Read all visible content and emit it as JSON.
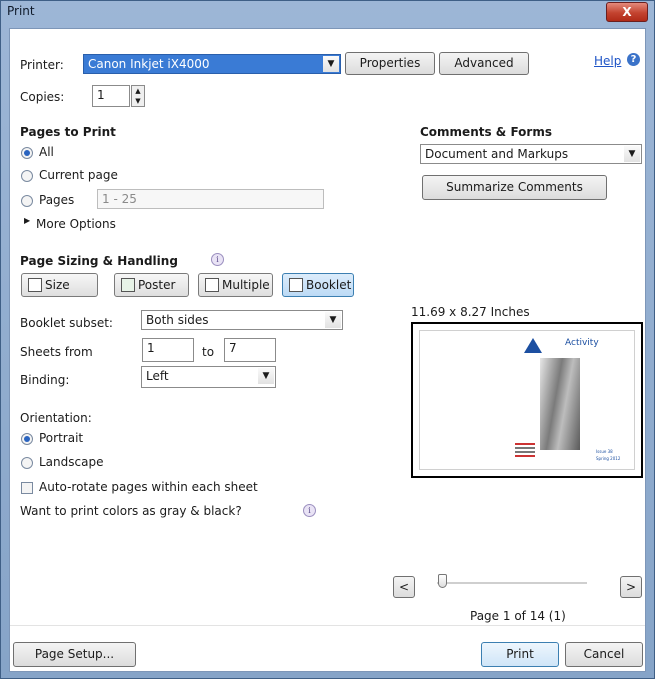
{
  "window": {
    "title": "Print",
    "close_label": "X"
  },
  "printer": {
    "label": "Printer:",
    "value": "Canon Inkjet iX4000",
    "properties_label": "Properties",
    "advanced_label": "Advanced",
    "help_label": "Help"
  },
  "copies": {
    "label": "Copies:",
    "value": "1"
  },
  "pages_to_print": {
    "heading": "Pages to Print",
    "all_label": "All",
    "current_label": "Current page",
    "pages_label": "Pages",
    "pages_value": "1 - 25",
    "selected": "All",
    "more_options_label": "More Options"
  },
  "comments_forms": {
    "heading": "Comments & Forms",
    "value": "Document and Markups",
    "summarize_label": "Summarize Comments"
  },
  "page_sizing": {
    "heading": "Page Sizing & Handling",
    "buttons": [
      "Size",
      "Poster",
      "Multiple",
      "Booklet"
    ],
    "selected": "Booklet",
    "booklet_subset_label": "Booklet subset:",
    "booklet_subset_value": "Both sides",
    "sheets_from_label": "Sheets from",
    "sheets_from_value": "1",
    "sheets_to_label": "to",
    "sheets_to_value": "7",
    "binding_label": "Binding:",
    "binding_value": "Left"
  },
  "orientation": {
    "label": "Orientation:",
    "portrait_label": "Portrait",
    "landscape_label": "Landscape",
    "selected": "Portrait"
  },
  "options": {
    "auto_rotate_label": "Auto-rotate pages within each sheet",
    "auto_rotate_checked": false,
    "gray_label": "Want to print colors as gray & black?"
  },
  "preview": {
    "size_label": "11.69 x 8.27 Inches",
    "thumb_title": "Activity",
    "thumb_issue": "Issue 38",
    "thumb_season": "Spring 2012",
    "prev_label": "<",
    "next_label": ">",
    "page_indicator": "Page 1 of 14 (1)"
  },
  "footer": {
    "page_setup_label": "Page Setup...",
    "print_label": "Print",
    "cancel_label": "Cancel"
  },
  "colors": {
    "title_gradient_top": "#9db6d6",
    "selection_blue": "#3a7bd5",
    "link_blue": "#1f55c7",
    "close_red": "#c3432f"
  }
}
